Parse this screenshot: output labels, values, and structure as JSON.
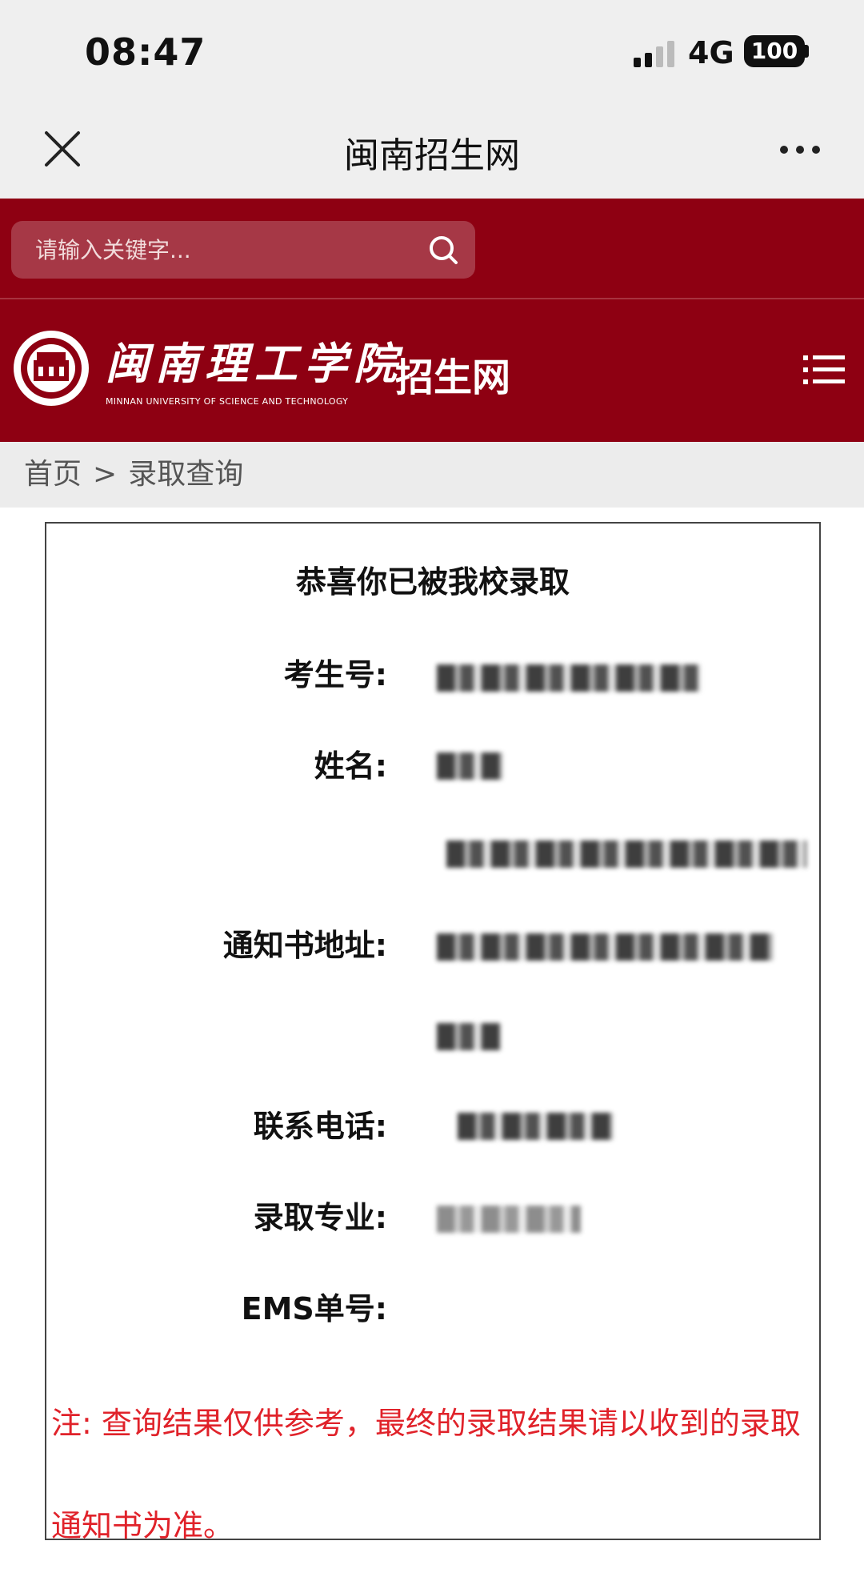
{
  "status_bar": {
    "time": "08:47",
    "network": "4G",
    "battery": "100"
  },
  "nav": {
    "title": "闽南招生网"
  },
  "search": {
    "placeholder": "请输入关键字..."
  },
  "header": {
    "logo_cn": "闽南理工学院",
    "logo_en": "MINNAN UNIVERSITY OF SCIENCE AND TECHNOLOGY",
    "site_name": "招生网"
  },
  "breadcrumb": {
    "home": "首页",
    "separator": ">",
    "current": "录取查询"
  },
  "result": {
    "title": "恭喜你已被我校录取",
    "labels": {
      "exam_no": "考生号:",
      "name": "姓名:",
      "address": "通知书地址:",
      "phone": "联系电话:",
      "major": "录取专业:",
      "ems": "EMS单号:"
    },
    "note": "注: 查询结果仅供参考，最终的录取结果请以收到的录取通知书为准。"
  },
  "colors": {
    "brand_red": "#8e0012",
    "note_red": "#e0222a"
  }
}
